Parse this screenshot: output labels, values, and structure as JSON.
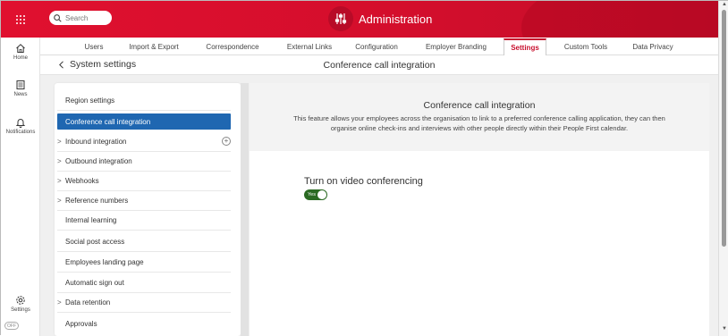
{
  "search": {
    "placeholder": "Search"
  },
  "header": {
    "title": "Administration"
  },
  "rail": {
    "items": [
      {
        "label": "Home",
        "icon": "home-icon"
      },
      {
        "label": "News",
        "icon": "news-icon"
      },
      {
        "label": "Notifications",
        "icon": "bell-icon"
      },
      {
        "label": "Settings",
        "icon": "gear-icon"
      }
    ],
    "toggle": "OFF"
  },
  "tabs": [
    {
      "label": "Users"
    },
    {
      "label": "Import & Export"
    },
    {
      "label": "Correspondence"
    },
    {
      "label": "External Links"
    },
    {
      "label": "Configuration"
    },
    {
      "label": "Employer Branding"
    },
    {
      "label": "Settings",
      "active": true
    },
    {
      "label": "Custom Tools"
    },
    {
      "label": "Data Privacy"
    }
  ],
  "subheader": {
    "back_label": "System settings",
    "title": "Conference call integration"
  },
  "menu": {
    "items": [
      {
        "label": "Region settings",
        "chevron": ""
      },
      {
        "label": "Conference call integration",
        "chevron": "",
        "active": true
      },
      {
        "label": "Inbound integration",
        "chevron": ">",
        "plus": true
      },
      {
        "label": "Outbound integration",
        "chevron": ">"
      },
      {
        "label": "Webhooks",
        "chevron": ">"
      },
      {
        "label": "Reference numbers",
        "chevron": ">"
      },
      {
        "label": "Internal learning",
        "chevron": ""
      },
      {
        "label": "Social post access",
        "chevron": ""
      },
      {
        "label": "Employees landing page",
        "chevron": ""
      },
      {
        "label": "Automatic sign out",
        "chevron": ""
      },
      {
        "label": "Data retention",
        "chevron": ">"
      },
      {
        "label": "Approvals",
        "chevron": ""
      }
    ]
  },
  "panel": {
    "title": "Conference call integration",
    "description": "This feature allows your employees across the organisation to link to a preferred conference calling application, they can then organise online check-ins and interviews with other people directly within their People First calendar.",
    "video_label": "Turn on video conferencing",
    "toggle_value": "Yes"
  },
  "colors": {
    "brand_red": "#d40e2c",
    "active_blue": "#1f67b1",
    "toggle_green": "#2b6a23"
  }
}
